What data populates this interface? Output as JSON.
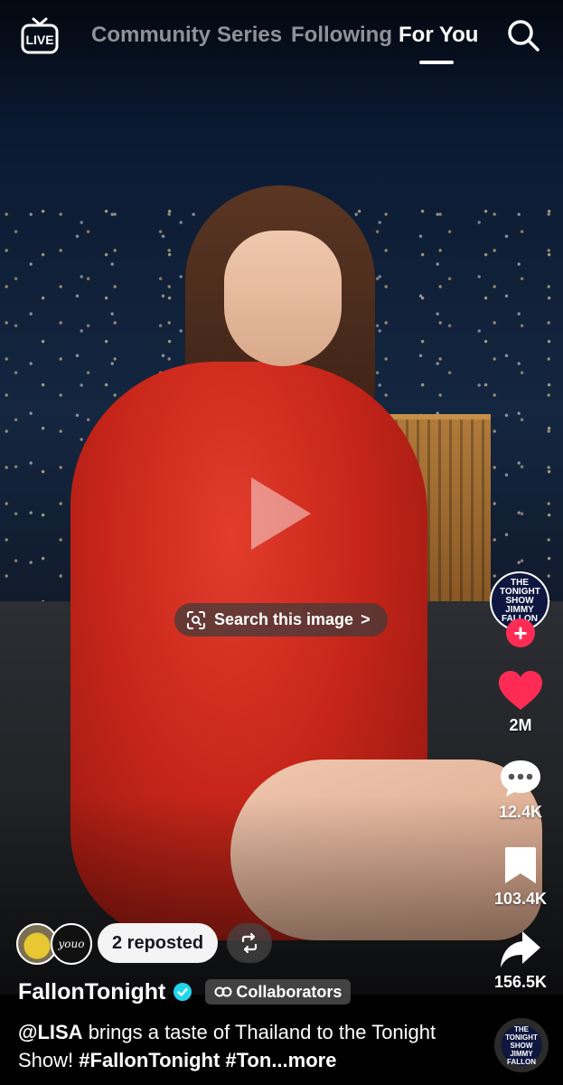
{
  "top_nav": {
    "live_label": "LIVE",
    "tabs": [
      "Community",
      "Series",
      "Following",
      "For You"
    ],
    "active_tab": "For You"
  },
  "overlay": {
    "search_image_label": "Search this image",
    "search_image_chevron": ">"
  },
  "right_rail": {
    "creator_logo_text": "THE TONIGHT SHOW JIMMY FALLON",
    "follow_symbol": "+",
    "likes": "2M",
    "comments": "12.4K",
    "saves": "103.4K",
    "shares": "156.5K"
  },
  "repost": {
    "second_avatar_text": "youo",
    "label": "2 reposted"
  },
  "post": {
    "author": "FallonTonight",
    "verified": true,
    "collaborators_label": "Collaborators",
    "caption_mention": "@LISA",
    "caption_text": " brings a taste of Thailand to the Tonight Show! ",
    "caption_tags": "#FallonTonight #Ton",
    "caption_more": "...more"
  },
  "colors": {
    "like_red": "#fe2c55",
    "verified_blue": "#20d5ec",
    "dress_red": "#c8261a"
  },
  "icons": {
    "live": "live-tv-icon",
    "search": "search-icon",
    "like": "heart-icon",
    "comment": "comment-bubble-icon",
    "save": "bookmark-icon",
    "share": "share-arrow-icon",
    "repost": "repost-icon",
    "collab": "link-icon",
    "play": "play-icon",
    "scan": "image-scan-icon"
  }
}
